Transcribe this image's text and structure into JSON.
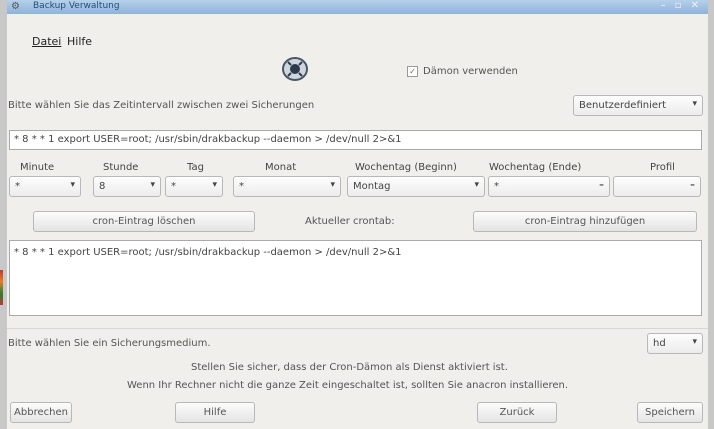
{
  "window": {
    "title": "Backup Verwaltung",
    "controls": "– ▫ ✕"
  },
  "menu": {
    "file": "Datei",
    "help": "Hilfe"
  },
  "daemon_checkbox": {
    "label": "Dämon verwenden",
    "checked": true
  },
  "interval_prompt": "Bitte wählen Sie das Zeitintervall zwischen zwei Sicherungen",
  "interval_select": "Benutzerdefiniert",
  "cron_line": "* 8 * * 1 export USER=root; /usr/sbin/drakbackup --daemon > /dev/null 2>&1",
  "columns": [
    "Minute",
    "Stunde",
    "Tag",
    "Monat",
    "Wochentag (Beginn)",
    "Wochentag (Ende)",
    "Profil"
  ],
  "fields": {
    "minute": "*",
    "stunde": "8",
    "tag": "*",
    "monat": "*",
    "wochentag_beginn": "Montag",
    "wochentag_ende": "*",
    "profil": ""
  },
  "buttons": {
    "delete_cron": "cron-Eintrag löschen",
    "add_cron": "cron-Eintrag hinzufügen",
    "cancel": "Abbrechen",
    "help": "Hilfe",
    "back": "Zurück",
    "save": "Speichern"
  },
  "current_crontab_label": "Aktueller crontab:",
  "crontab_content": "* 8 * * 1 export USER=root; /usr/sbin/drakbackup --daemon > /dev/null 2>&1",
  "medium_prompt": "Bitte wählen Sie ein Sicherungsmedium.",
  "medium_select": "hd",
  "notice_1": "Stellen Sie sicher, dass der Cron-Dämon als Dienst aktiviert ist.",
  "notice_2": "Wenn Ihr Rechner nicht die ganze Zeit eingeschaltet ist, sollten Sie anacron installieren."
}
